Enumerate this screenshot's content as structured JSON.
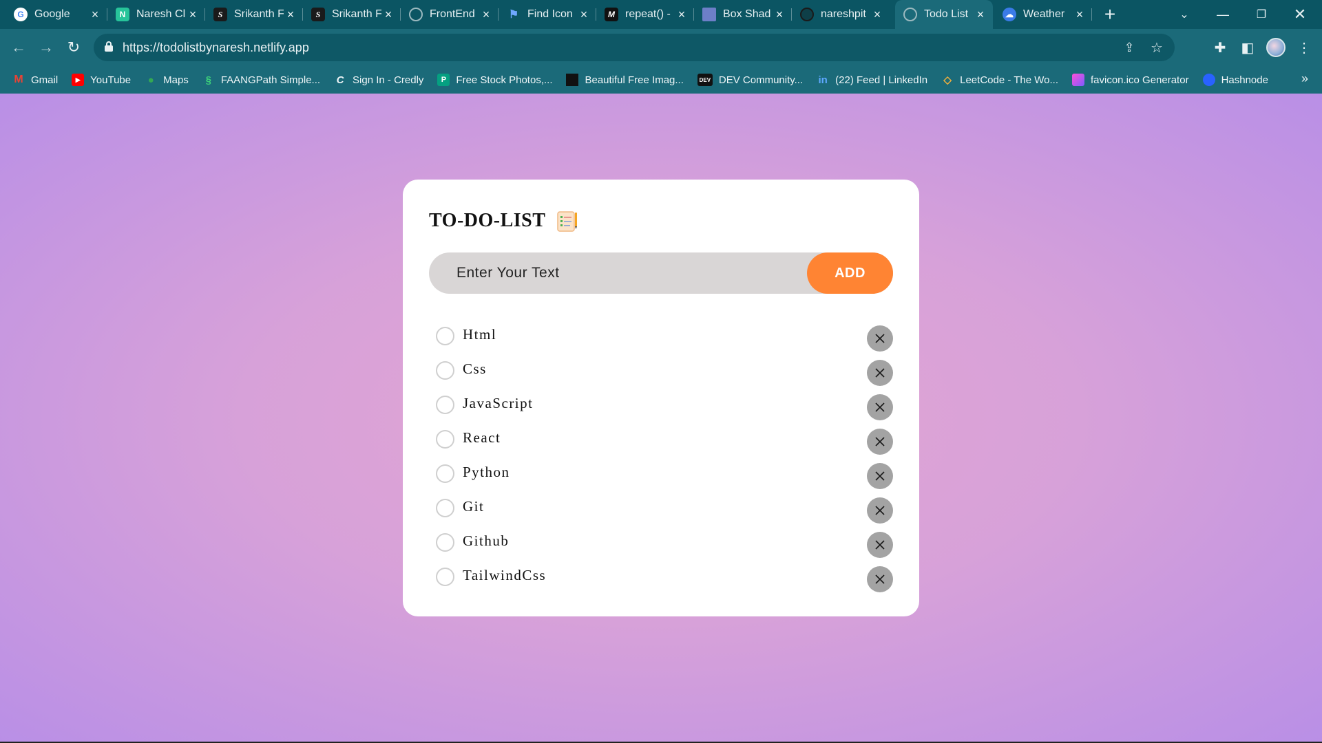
{
  "browser": {
    "tabs": [
      {
        "title": "Google",
        "favicon": "google-icon",
        "active": false
      },
      {
        "title": "Naresh Cl",
        "favicon": "naresh-site-icon",
        "active": false
      },
      {
        "title": "Srikanth F",
        "favicon": "srikanth-icon",
        "active": false
      },
      {
        "title": "Srikanth F",
        "favicon": "srikanth-icon",
        "active": false
      },
      {
        "title": "FrontEnd",
        "favicon": "globe-icon",
        "active": false
      },
      {
        "title": "Find Icon",
        "favicon": "flag-icon",
        "active": false
      },
      {
        "title": "repeat() -",
        "favicon": "mdn-icon",
        "active": false
      },
      {
        "title": "Box Shad",
        "favicon": "box-shadow-icon",
        "active": false
      },
      {
        "title": "nareshpit",
        "favicon": "github-icon",
        "active": false
      },
      {
        "title": "Todo List",
        "favicon": "globe-icon",
        "active": true
      },
      {
        "title": "Weather",
        "favicon": "weather-icon",
        "active": false
      }
    ],
    "url": "https://todolistbynaresh.netlify.app",
    "bookmarks": [
      {
        "label": "Gmail",
        "favicon": "gmail-icon"
      },
      {
        "label": "YouTube",
        "favicon": "youtube-icon"
      },
      {
        "label": "Maps",
        "favicon": "maps-icon"
      },
      {
        "label": "FAANGPath Simple...",
        "favicon": "faangpath-icon"
      },
      {
        "label": "Sign In - Credly",
        "favicon": "credly-icon"
      },
      {
        "label": "Free Stock Photos,...",
        "favicon": "pexels-icon"
      },
      {
        "label": "Beautiful Free Imag...",
        "favicon": "unsplash-icon"
      },
      {
        "label": "DEV Community...",
        "favicon": "dev-icon"
      },
      {
        "label": "(22) Feed | LinkedIn",
        "favicon": "linkedin-icon"
      },
      {
        "label": "LeetCode - The Wo...",
        "favicon": "leetcode-icon"
      },
      {
        "label": "favicon.ico Generator",
        "favicon": "favicon-generator-icon"
      },
      {
        "label": "Hashnode",
        "favicon": "hashnode-icon"
      }
    ]
  },
  "app": {
    "title": "TO-DO-LIST",
    "title_icon": "notepad-icon",
    "input_placeholder": "Enter Your Text",
    "input_value": "",
    "add_label": "ADD",
    "items": [
      {
        "text": "Html",
        "done": false
      },
      {
        "text": "Css",
        "done": false
      },
      {
        "text": "JavaScript",
        "done": false
      },
      {
        "text": "React",
        "done": false
      },
      {
        "text": "Python",
        "done": false
      },
      {
        "text": "Git",
        "done": false
      },
      {
        "text": "Github",
        "done": false
      },
      {
        "text": "TailwindCss",
        "done": false
      }
    ]
  },
  "colors": {
    "browser_frame": "#0b5563",
    "toolbar": "#1b6a79",
    "add_button": "#ff8433",
    "input_background": "#d9d6d6",
    "delete_button": "#a3a3a3",
    "page_gradient_center": "#e3a6d2",
    "page_gradient_edge": "#b98fe6"
  }
}
